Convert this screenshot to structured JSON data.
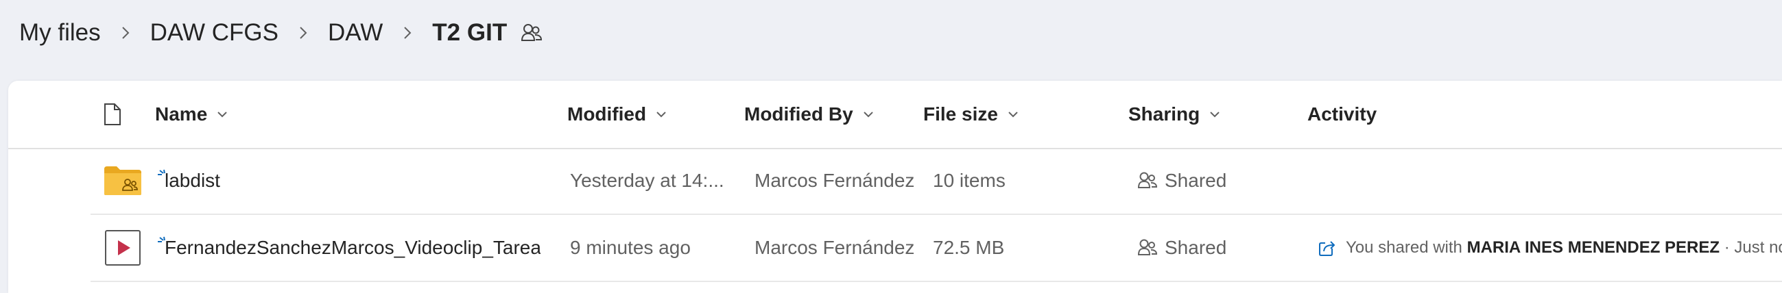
{
  "breadcrumb": {
    "items": [
      "My files",
      "DAW CFGS",
      "DAW"
    ],
    "current": "T2 GIT",
    "current_icon": "shared-people-icon"
  },
  "table": {
    "columns": {
      "type_icon": "file-icon",
      "name": "Name",
      "modified": "Modified",
      "modified_by": "Modified By",
      "file_size": "File size",
      "sharing": "Sharing",
      "activity": "Activity"
    },
    "rows": [
      {
        "icon": "shared-folder-icon",
        "name": "labdist",
        "modified": "Yesterday at 14:...",
        "modified_by": "Marcos Fernández S",
        "file_size": "10 items",
        "sharing": "Shared",
        "activity": {
          "prefix": "",
          "person": "",
          "suffix": ""
        }
      },
      {
        "icon": "video-file-icon",
        "name": "FernandezSanchezMarcos_Videoclip_Tarea...",
        "modified": "9 minutes ago",
        "modified_by": "Marcos Fernández S",
        "file_size": "72.5 MB",
        "sharing": "Shared",
        "activity": {
          "prefix": "You shared with",
          "person": "MARIA INES MENENDEZ PEREZ",
          "suffix": "· Just now"
        }
      }
    ]
  },
  "colors": {
    "background": "#eef0f5",
    "panel": "#ffffff",
    "accent": "#0f6cbd",
    "folder": "#f7c142",
    "video_play": "#c4314b"
  }
}
